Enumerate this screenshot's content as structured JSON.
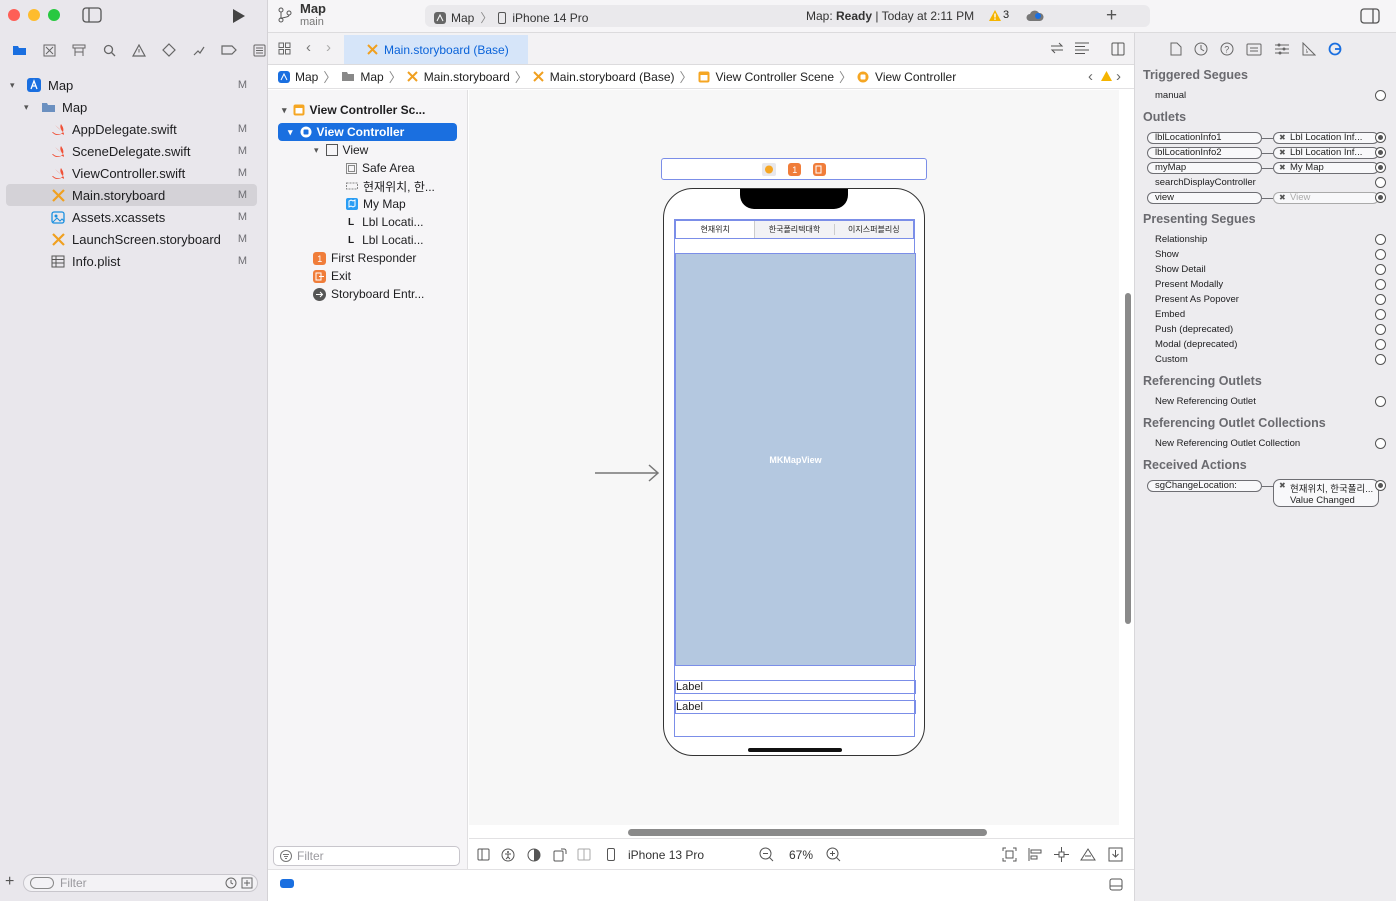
{
  "project": {
    "name": "Map",
    "branch": "main"
  },
  "scheme": {
    "target": "Map",
    "device": "iPhone 14 Pro"
  },
  "build_status": {
    "prefix": "Map: ",
    "state": "Ready",
    "time": "| Today at 2:11 PM",
    "warnings": "3"
  },
  "navigator": {
    "items": [
      {
        "label": "Map",
        "badge": "M",
        "icon": "project-icon"
      },
      {
        "label": "Map",
        "badge": "",
        "icon": "folder-icon"
      },
      {
        "label": "AppDelegate.swift",
        "badge": "M",
        "icon": "swift-icon"
      },
      {
        "label": "SceneDelegate.swift",
        "badge": "M",
        "icon": "swift-icon"
      },
      {
        "label": "ViewController.swift",
        "badge": "M",
        "icon": "swift-icon"
      },
      {
        "label": "Main.storyboard",
        "badge": "M",
        "icon": "storyboard-icon"
      },
      {
        "label": "Assets.xcassets",
        "badge": "M",
        "icon": "assets-icon"
      },
      {
        "label": "LaunchScreen.storyboard",
        "badge": "M",
        "icon": "storyboard-icon"
      },
      {
        "label": "Info.plist",
        "badge": "M",
        "icon": "plist-icon"
      }
    ],
    "filter_placeholder": "Filter"
  },
  "editor": {
    "tab_label": "Main.storyboard (Base)",
    "breadcrumb": [
      "Map",
      "Map",
      "Main.storyboard",
      "Main.storyboard (Base)",
      "View Controller Scene",
      "View Controller"
    ]
  },
  "outline": {
    "items": [
      {
        "label": "View Controller Sc..."
      },
      {
        "label": "View Controller"
      },
      {
        "label": "View"
      },
      {
        "label": "Safe Area"
      },
      {
        "label": "현재위치, 한..."
      },
      {
        "label": "My Map"
      },
      {
        "label": "Lbl Locati..."
      },
      {
        "label": "Lbl Locati..."
      },
      {
        "label": "First Responder"
      },
      {
        "label": "Exit"
      },
      {
        "label": "Storyboard Entr..."
      }
    ],
    "filter_placeholder": "Filter"
  },
  "canvas": {
    "segments": [
      "현재위치",
      "한국폴리텍대학",
      "이지스퍼블리싱"
    ],
    "map_label": "MKMapView",
    "label1": "Label",
    "label2": "Label",
    "device": "iPhone 13 Pro",
    "zoom": "67%"
  },
  "inspector": {
    "triggered_segues_title": "Triggered Segues",
    "triggered_segues": [
      "manual"
    ],
    "outlets_title": "Outlets",
    "outlets": [
      {
        "name": "lblLocationInfo1",
        "target": "Lbl Location Inf..."
      },
      {
        "name": "lblLocationInfo2",
        "target": "Lbl Location Inf..."
      },
      {
        "name": "myMap",
        "target": "My Map"
      },
      {
        "name": "searchDisplayController",
        "target": ""
      },
      {
        "name": "view",
        "target": "View"
      }
    ],
    "presenting_segues_title": "Presenting Segues",
    "presenting_segues": [
      "Relationship",
      "Show",
      "Show Detail",
      "Present Modally",
      "Present As Popover",
      "Embed",
      "Push (deprecated)",
      "Modal (deprecated)",
      "Custom"
    ],
    "referencing_outlets_title": "Referencing Outlets",
    "referencing_outlets": [
      "New Referencing Outlet"
    ],
    "referencing_collections_title": "Referencing Outlet Collections",
    "referencing_collections": [
      "New Referencing Outlet Collection"
    ],
    "received_actions_title": "Received Actions",
    "received_action": {
      "name": "sgChangeLocation:",
      "target": "현재위치, 한국폴리...",
      "event": "Value Changed"
    }
  },
  "colors": {
    "accent": "#0a63d9",
    "selection": "#1a6fe0",
    "map": "#b4c8e0",
    "swift": "#f05138",
    "storyboard": "#f0a020"
  }
}
